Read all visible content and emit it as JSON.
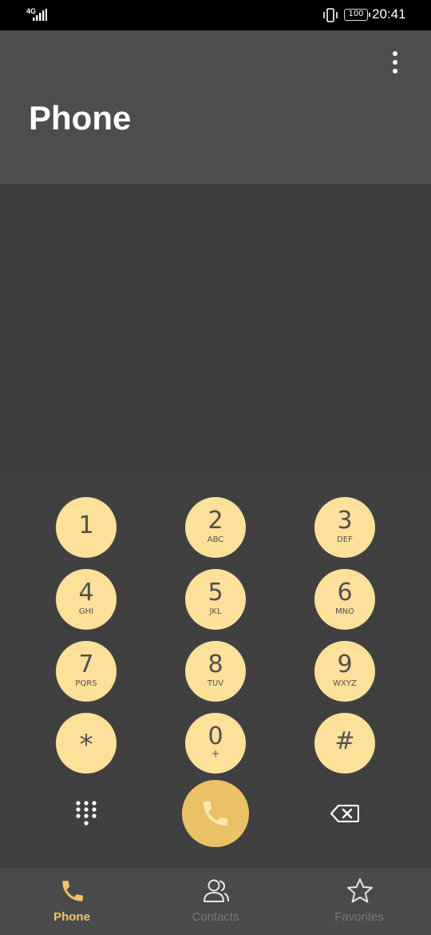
{
  "status_bar": {
    "network": "4G",
    "battery": "100",
    "time": "20:41"
  },
  "header": {
    "title": "Phone"
  },
  "dialer": {
    "number": ""
  },
  "keypad": {
    "keys": [
      {
        "digit": "1",
        "letters": ""
      },
      {
        "digit": "2",
        "letters": "ABC"
      },
      {
        "digit": "3",
        "letters": "DEF"
      },
      {
        "digit": "4",
        "letters": "GHI"
      },
      {
        "digit": "5",
        "letters": "JKL"
      },
      {
        "digit": "6",
        "letters": "MNO"
      },
      {
        "digit": "7",
        "letters": "PQRS"
      },
      {
        "digit": "8",
        "letters": "TUV"
      },
      {
        "digit": "9",
        "letters": "WXYZ"
      },
      {
        "digit": "*",
        "letters": ""
      },
      {
        "digit": "0",
        "letters": "+"
      },
      {
        "digit": "#",
        "letters": ""
      }
    ]
  },
  "nav": {
    "items": [
      {
        "label": "Phone",
        "icon": "phone-icon",
        "active": true
      },
      {
        "label": "Contacts",
        "icon": "contacts-icon",
        "active": false
      },
      {
        "label": "Favorites",
        "icon": "star-icon",
        "active": false
      }
    ]
  },
  "colors": {
    "accent": "#f1c46b",
    "key_fill": "#fde09a",
    "call_button": "#ebc167",
    "header_bg": "#4d4d4d",
    "body_bg": "#3c3c3c"
  }
}
